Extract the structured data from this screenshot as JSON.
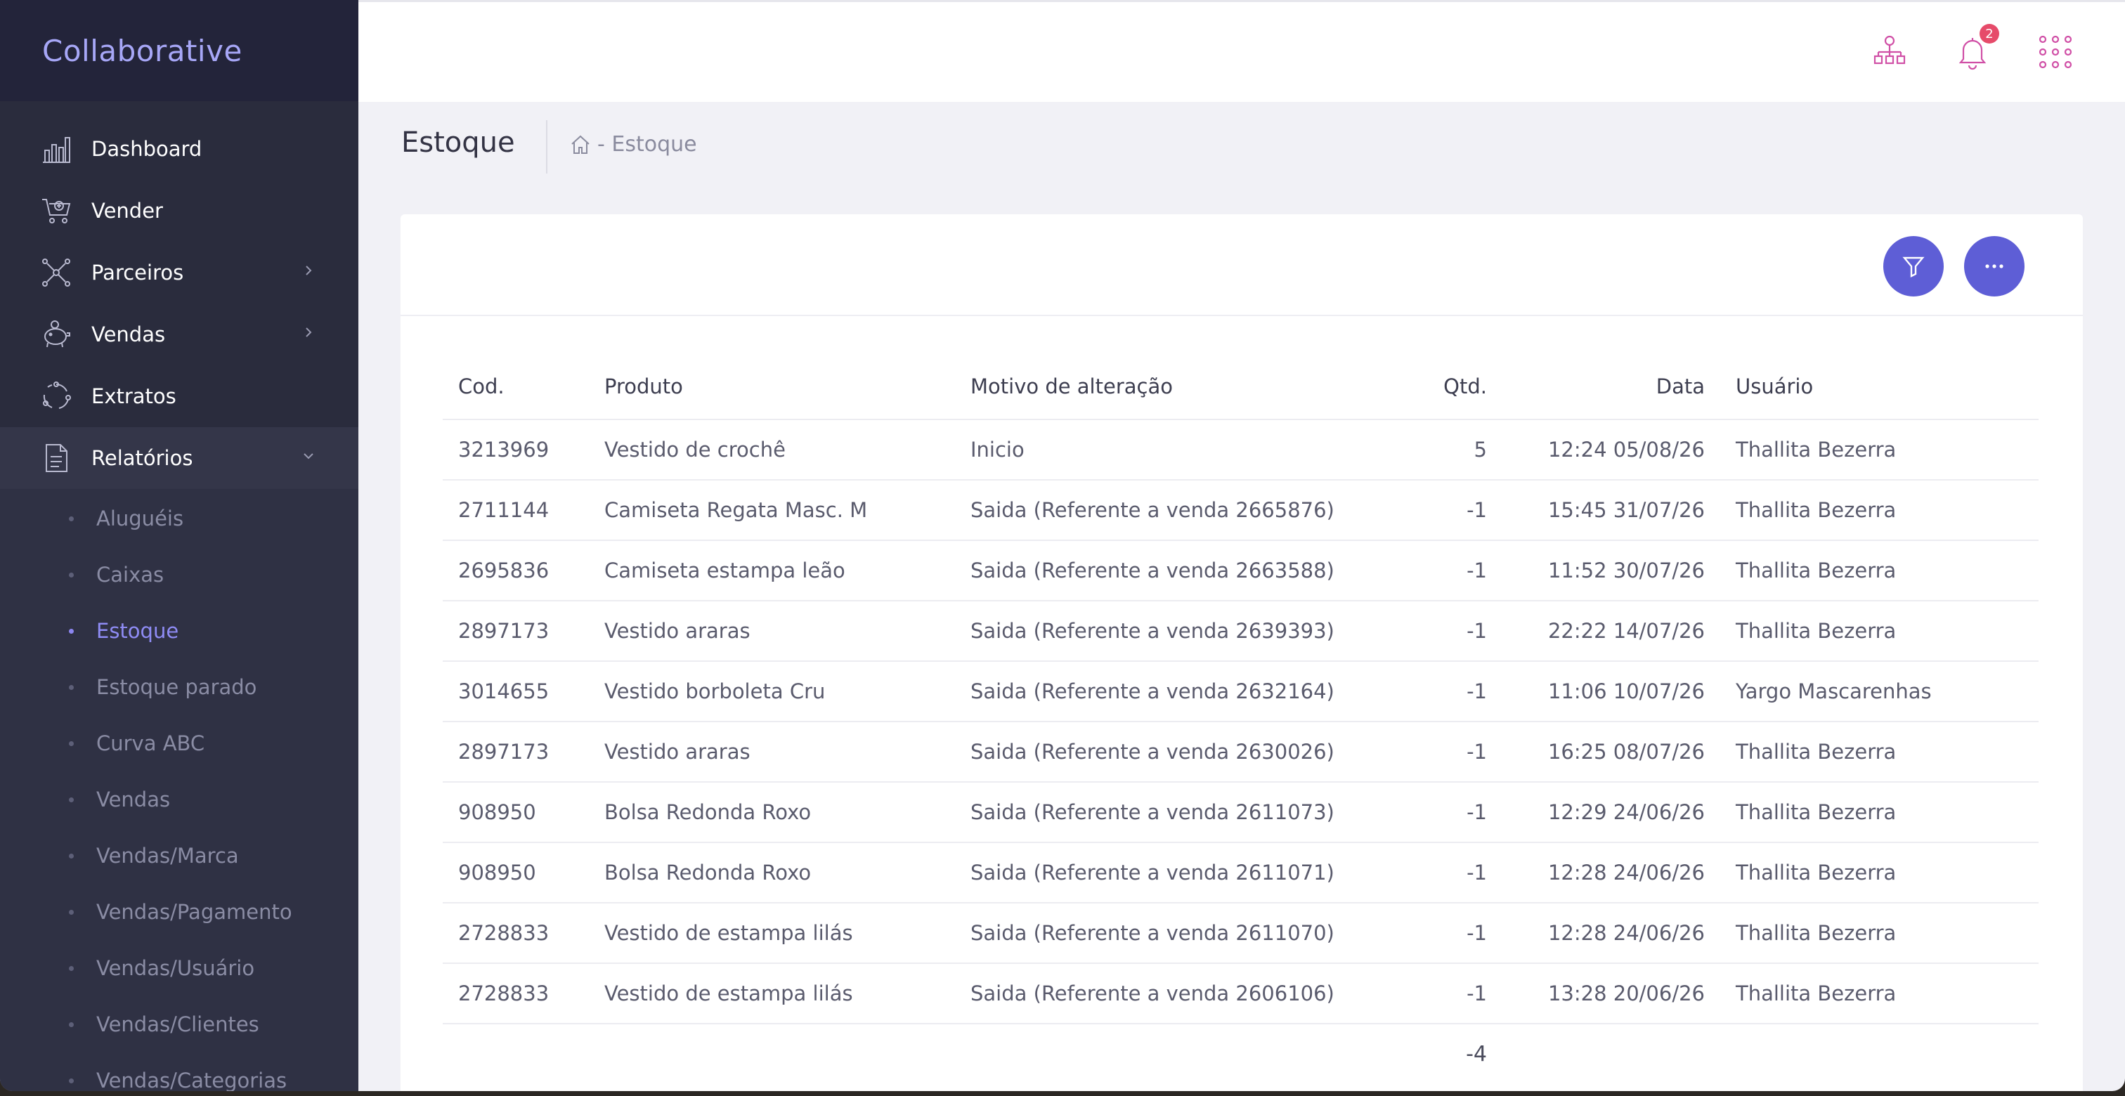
{
  "app": {
    "brand": "Collaborative"
  },
  "sidebar": {
    "items": [
      {
        "label": "Dashboard",
        "icon": "bar-chart-icon"
      },
      {
        "label": "Vender",
        "icon": "cart-icon"
      },
      {
        "label": "Parceiros",
        "icon": "network-icon",
        "has_children": true
      },
      {
        "label": "Vendas",
        "icon": "piggy-bank-icon",
        "has_children": true
      },
      {
        "label": "Extratos",
        "icon": "cycle-icon"
      },
      {
        "label": "Relatórios",
        "icon": "document-icon",
        "has_children": true,
        "expanded": true
      }
    ],
    "submenu": [
      {
        "label": "Aluguéis"
      },
      {
        "label": "Caixas"
      },
      {
        "label": "Estoque",
        "active": true
      },
      {
        "label": "Estoque parado"
      },
      {
        "label": "Curva ABC"
      },
      {
        "label": "Vendas"
      },
      {
        "label": "Vendas/Marca"
      },
      {
        "label": "Vendas/Pagamento"
      },
      {
        "label": "Vendas/Usuário"
      },
      {
        "label": "Vendas/Clientes"
      },
      {
        "label": "Vendas/Categorias"
      }
    ]
  },
  "header": {
    "icons": [
      "org-chart-icon",
      "bell-icon",
      "apps-grid-icon"
    ],
    "notification_count": "2",
    "accent": "#d04fa6"
  },
  "page": {
    "title": "Estoque",
    "breadcrumb": "- Estoque"
  },
  "toolbar": {
    "filter_icon": "filter-icon",
    "more_icon": "more-icon",
    "button_color": "#5e5ed6"
  },
  "table": {
    "columns": [
      "Cod.",
      "Produto",
      "Motivo de alteração",
      "Qtd.",
      "Data",
      "Usuário"
    ],
    "rows": [
      [
        "3213969",
        "Vestido de crochê",
        "Inicio",
        "5",
        "12:24 05/08/26",
        "Thallita Bezerra"
      ],
      [
        "2711144",
        "Camiseta Regata Masc. M",
        "Saida (Referente a venda 2665876)",
        "-1",
        "15:45 31/07/26",
        "Thallita Bezerra"
      ],
      [
        "2695836",
        "Camiseta estampa leão",
        "Saida (Referente a venda 2663588)",
        "-1",
        "11:52 30/07/26",
        "Thallita Bezerra"
      ],
      [
        "2897173",
        "Vestido araras",
        "Saida (Referente a venda 2639393)",
        "-1",
        "22:22 14/07/26",
        "Thallita Bezerra"
      ],
      [
        "3014655",
        "Vestido borboleta Cru",
        "Saida (Referente a venda 2632164)",
        "-1",
        "11:06 10/07/26",
        "Yargo Mascarenhas"
      ],
      [
        "2897173",
        "Vestido araras",
        "Saida (Referente a venda 2630026)",
        "-1",
        "16:25 08/07/26",
        "Thallita Bezerra"
      ],
      [
        "908950",
        "Bolsa Redonda Roxo",
        "Saida (Referente a venda 2611073)",
        "-1",
        "12:29 24/06/26",
        "Thallita Bezerra"
      ],
      [
        "908950",
        "Bolsa Redonda Roxo",
        "Saida (Referente a venda 2611071)",
        "-1",
        "12:28 24/06/26",
        "Thallita Bezerra"
      ],
      [
        "2728833",
        "Vestido de estampa lilás",
        "Saida (Referente a venda 2611070)",
        "-1",
        "12:28 24/06/26",
        "Thallita Bezerra"
      ],
      [
        "2728833",
        "Vestido de estampa lilás",
        "Saida (Referente a venda 2606106)",
        "-1",
        "13:28 20/06/26",
        "Thallita Bezerra"
      ]
    ],
    "total_qty": "-4"
  }
}
